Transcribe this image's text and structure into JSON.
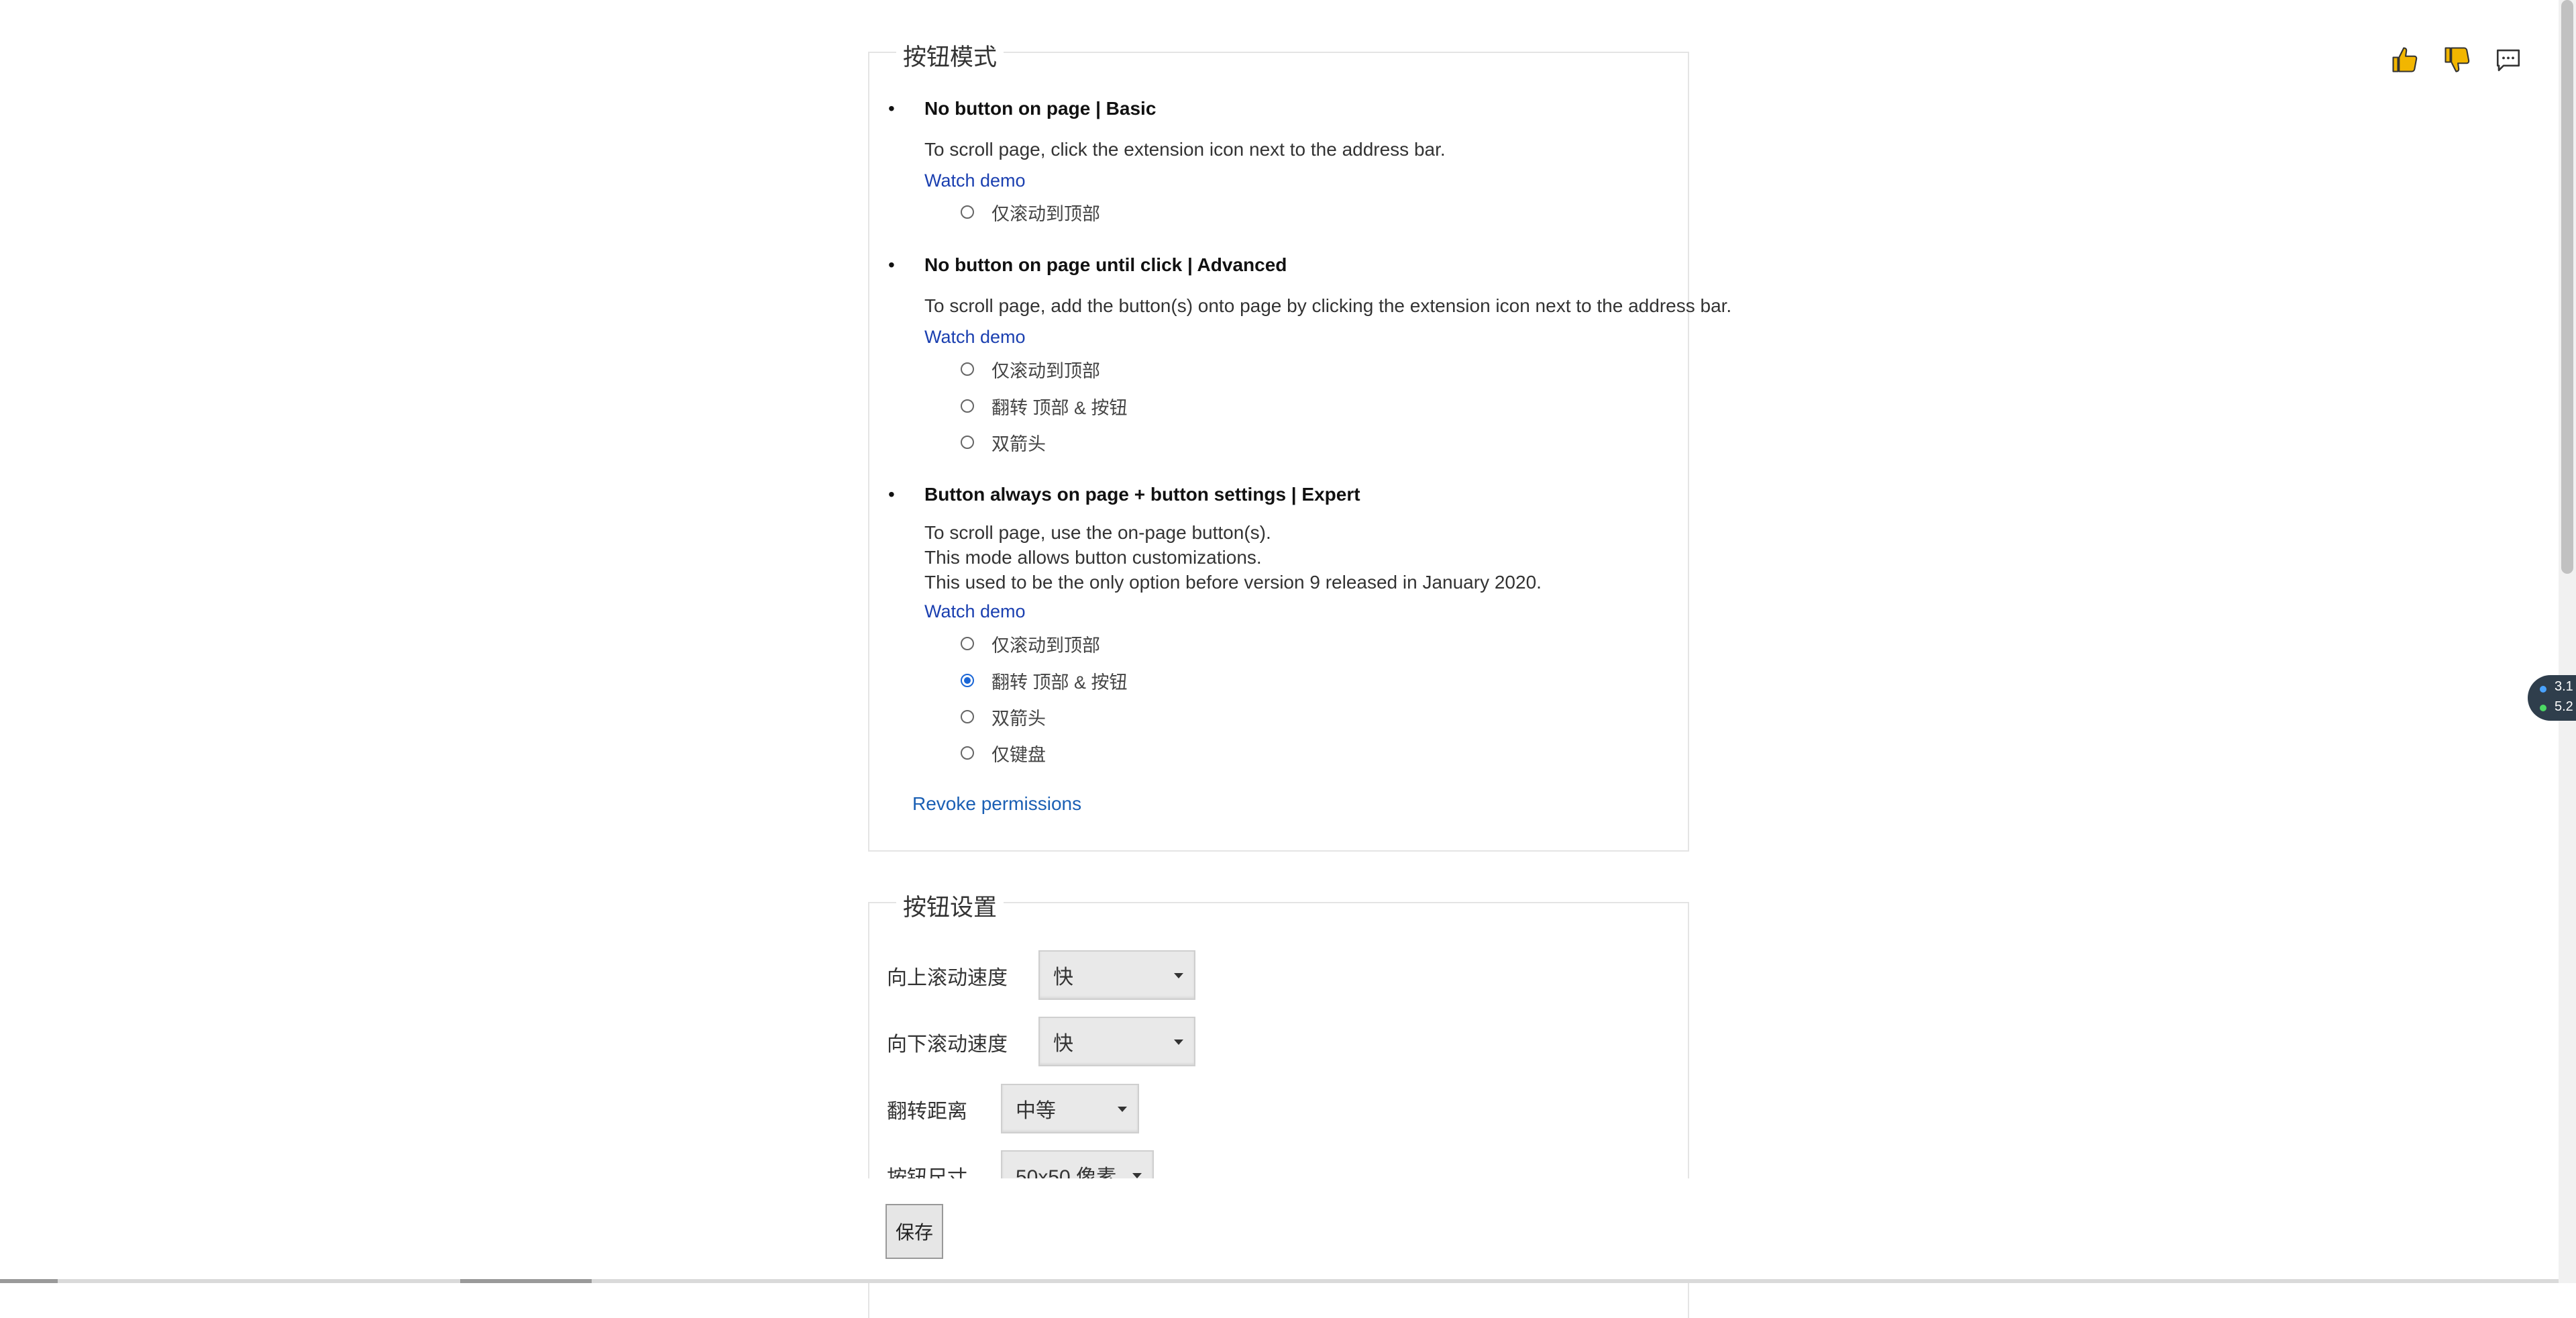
{
  "mode_section": {
    "legend": "按钮模式",
    "modes": [
      {
        "title": "No button on page | Basic",
        "desc": [
          "To scroll page, click the extension icon next to the address bar."
        ],
        "demo": "Watch demo",
        "options": [
          {
            "label": "仅滚动到顶部",
            "checked": false
          }
        ]
      },
      {
        "title": "No button on page until click | Advanced",
        "desc": [
          "To scroll page, add the button(s) onto page by clicking the extension icon next to the address bar."
        ],
        "demo": "Watch demo",
        "options": [
          {
            "label": "仅滚动到顶部",
            "checked": false
          },
          {
            "label": "翻转 顶部 & 按钮",
            "checked": false
          },
          {
            "label": "双箭头",
            "checked": false
          }
        ]
      },
      {
        "title": "Button always on page + button settings | Expert",
        "desc": [
          "To scroll page, use the on-page button(s).",
          "This mode allows button customizations.",
          "This used to be the only option before version 9 released in January 2020."
        ],
        "demo": "Watch demo",
        "options": [
          {
            "label": "仅滚动到顶部",
            "checked": false
          },
          {
            "label": "翻转 顶部 & 按钮",
            "checked": true
          },
          {
            "label": "双箭头",
            "checked": false
          },
          {
            "label": "仅键盘",
            "checked": false
          }
        ]
      }
    ],
    "revoke": "Revoke permissions"
  },
  "settings_section": {
    "legend": "按钮设置",
    "rows": [
      {
        "label": "向上滚动速度",
        "value": "快"
      },
      {
        "label": "向下滚动速度",
        "value": "快"
      },
      {
        "label": "翻转距离",
        "value": "中等"
      },
      {
        "label": "按钮尺寸",
        "value": "50x50 像素"
      }
    ]
  },
  "save_label": "保存",
  "floating_widget": {
    "line1": "3.1",
    "line2": "5.2"
  },
  "icons": [
    "thumbs-up-icon",
    "thumbs-down-icon",
    "comment-icon"
  ],
  "colors": {
    "link": "#1a3fb0",
    "radio_checked": "#1a66d6",
    "thumbs": "#e8b000"
  }
}
